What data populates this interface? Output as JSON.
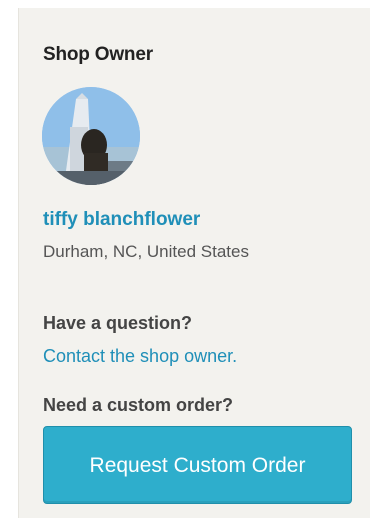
{
  "shop_owner": {
    "section_title": "Shop Owner",
    "name": "tiffy blanchflower",
    "location": "Durham, NC, United States"
  },
  "contact": {
    "question": "Have a question?",
    "link_text": "Contact the shop owner."
  },
  "custom_order": {
    "question": "Need a custom order?",
    "button_label": "Request Custom Order"
  },
  "colors": {
    "panel_background": "#f3f2ee",
    "link": "#1f8fb8",
    "button": "#2eaecc"
  }
}
